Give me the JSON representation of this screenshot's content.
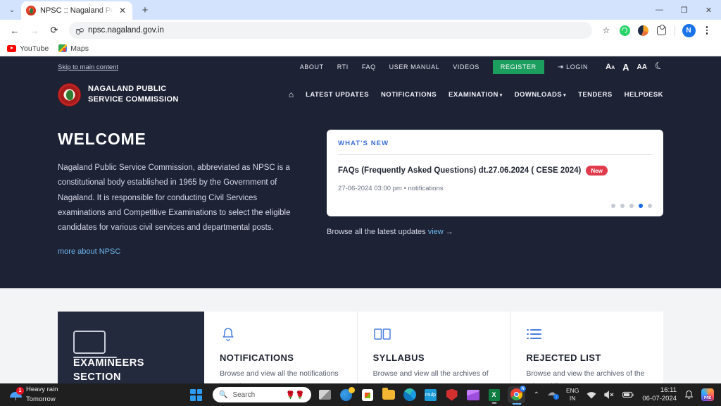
{
  "browser": {
    "tab_title": "NPSC :: Nagaland Public Service",
    "tab_close": "✕",
    "new_tab": "+",
    "tab_dropdown": "⌄",
    "back": "←",
    "forward": "→",
    "reload": "⟳",
    "url": "npsc.nagaland.gov.in",
    "bookmark_star": "☆",
    "profile_initial": "N",
    "minimize": "—",
    "maximize": "❐",
    "close": "✕",
    "bookmarks": [
      {
        "label": "YouTube"
      },
      {
        "label": "Maps"
      }
    ]
  },
  "site": {
    "topbar": {
      "skip_link": "Skip to main content",
      "links": [
        "ABOUT",
        "RTI",
        "FAQ",
        "USER MANUAL",
        "VIDEOS"
      ],
      "register": "REGISTER",
      "login": "LOGIN",
      "font_decrease": "A",
      "font_decrease_sub": "A",
      "font_normal": "A",
      "font_increase": "A",
      "font_increase_sub": "A"
    },
    "logo": {
      "line1": "NAGALAND PUBLIC",
      "line2": "SERVICE COMMISSION"
    },
    "mainnav": {
      "home_icon": "⌂",
      "items": [
        {
          "label": "LATEST UPDATES",
          "caret": ""
        },
        {
          "label": "NOTIFICATIONS",
          "caret": ""
        },
        {
          "label": "EXAMINATION",
          "caret": "▾"
        },
        {
          "label": "DOWNLOADS",
          "caret": "▾"
        },
        {
          "label": "TENDERS",
          "caret": ""
        },
        {
          "label": "HELPDESK",
          "caret": ""
        }
      ]
    },
    "hero": {
      "heading": "WELCOME",
      "body": "Nagaland Public Service Commission, abbreviated as NPSC is a constitutional body established in 1965 by the Government of Nagaland. It is responsible for conducting Civil Services examinations and Competitive Examinations to select the eligible candidates for various civil services and departmental posts.",
      "more_link": "more about NPSC"
    },
    "whats_new": {
      "title": "WHAT'S NEW",
      "item_title": "FAQs (Frequently Asked Questions) dt.27.06.2024 ( CESE 2024)",
      "badge": "New",
      "meta": "27-06-2024 03:00 pm • notifications",
      "dots_total": 5,
      "dot_active_index": 3,
      "accent_color": "#1367e8"
    },
    "browse": {
      "text": "Browse all the latest updates ",
      "link": "view",
      "arrow": "→"
    },
    "cards": [
      {
        "kind": "dark",
        "icon": "laptop-icon",
        "title": "EXAMINEERS SECTION",
        "body": ""
      },
      {
        "kind": "light",
        "icon": "bell-icon",
        "title": "NOTIFICATIONS",
        "body": "Browse and view all the notifications issued."
      },
      {
        "kind": "light",
        "icon": "book-icon",
        "title": "SYLLABUS",
        "body": "Browse and view all the archives of syllabus."
      },
      {
        "kind": "light",
        "icon": "list-icon",
        "title": "REJECTED LIST",
        "body": "Browse and view the archives of the rejected lists."
      }
    ]
  },
  "taskbar": {
    "weather": {
      "badge": "1",
      "line1": "Heavy rain",
      "line2": "Tomorrow"
    },
    "search_placeholder": "Search",
    "search_emoji": "🌹🌹",
    "chrome_badge": "N",
    "excel_letter": "X",
    "mulp_letter": "mulp",
    "tray": {
      "chevron": "⌃",
      "onedrive_badge": "↓",
      "language_line1": "ENG",
      "language_line2": "IN",
      "wifi": "▲",
      "volume": "🔇",
      "battery": "▭",
      "time": "16:11",
      "date": "06-07-2024",
      "notification_bell": "🔔",
      "copilot_label": "PRE"
    }
  }
}
